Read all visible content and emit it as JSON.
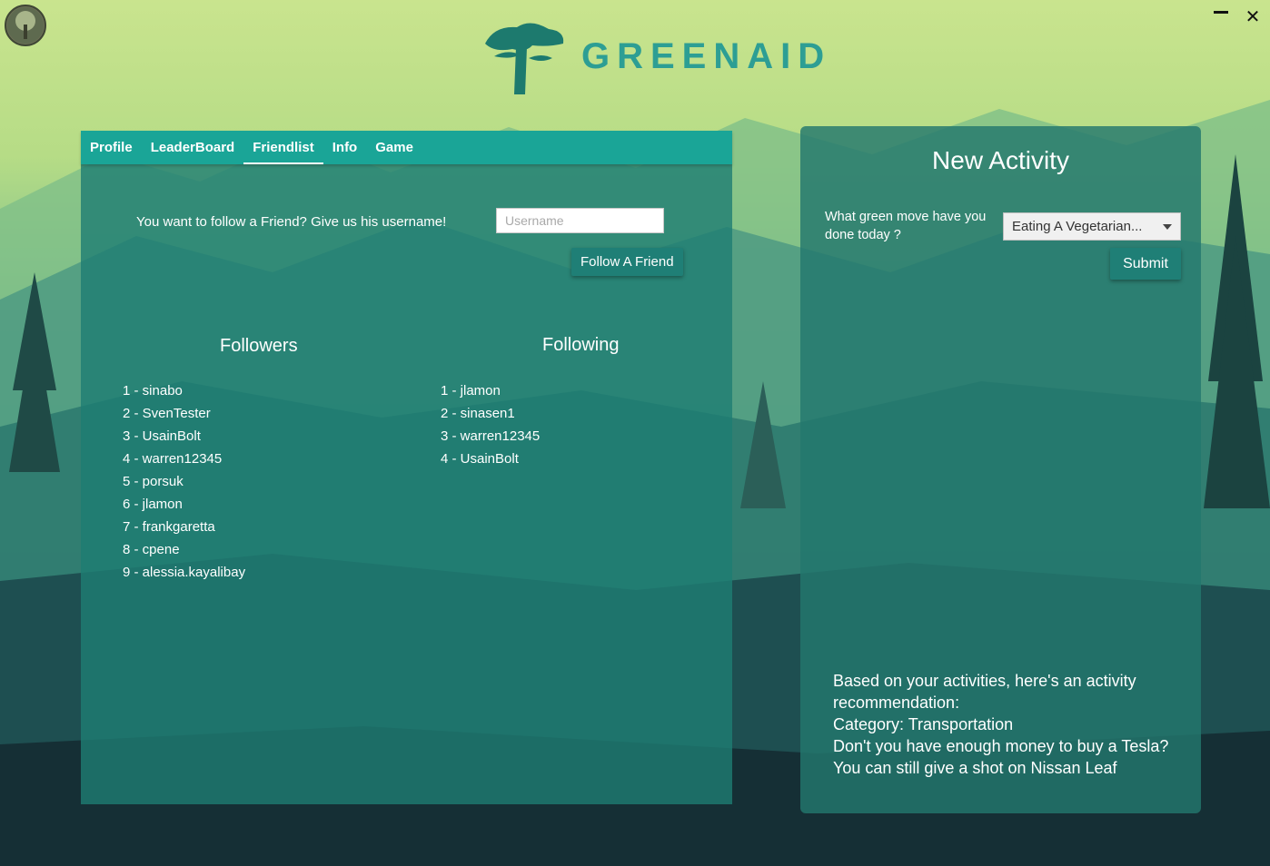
{
  "window": {
    "brand_name": "GREENAID",
    "logo_icon": "tree-logo-icon",
    "controls": {
      "minimize_icon": "minimize-icon",
      "close_icon": "close-icon",
      "close_glyph": "✕"
    }
  },
  "tabs": [
    {
      "label": "Profile"
    },
    {
      "label": "LeaderBoard"
    },
    {
      "label": "Friendlist",
      "active": true
    },
    {
      "label": "Info"
    },
    {
      "label": "Game"
    }
  ],
  "friendlist": {
    "prompt": "You want to follow a Friend? Give us his username!",
    "username_placeholder": "Username",
    "username_value": "",
    "follow_button": "Follow A Friend",
    "followers_title": "Followers",
    "following_title": "Following",
    "followers": [
      "1 - sinabo",
      "2 - SvenTester",
      "3 - UsainBolt",
      "4 - warren12345",
      "5 - porsuk",
      "6 - jlamon",
      "7 - frankgaretta",
      "8 - cpene",
      "9 - alessia.kayalibay"
    ],
    "following": [
      "1 - jlamon",
      "2 - sinasen1",
      "3 - warren12345",
      "4 - UsainBolt"
    ]
  },
  "new_activity": {
    "title": "New Activity",
    "question": "What green move have you done today ?",
    "selected_activity": "Eating A Vegetarian...",
    "submit_button": "Submit",
    "recommendation": [
      "Based on your activities, here's an activity",
      "recommendation:",
      "Category: Transportation",
      "Don't you have enough money to buy a Tesla?",
      "You can still give a shot on Nissan Leaf"
    ]
  },
  "colors": {
    "accent": "#1aa597",
    "button": "#1f7f76",
    "brand_text": "#2d9e94",
    "panel": "#1e7d73"
  }
}
